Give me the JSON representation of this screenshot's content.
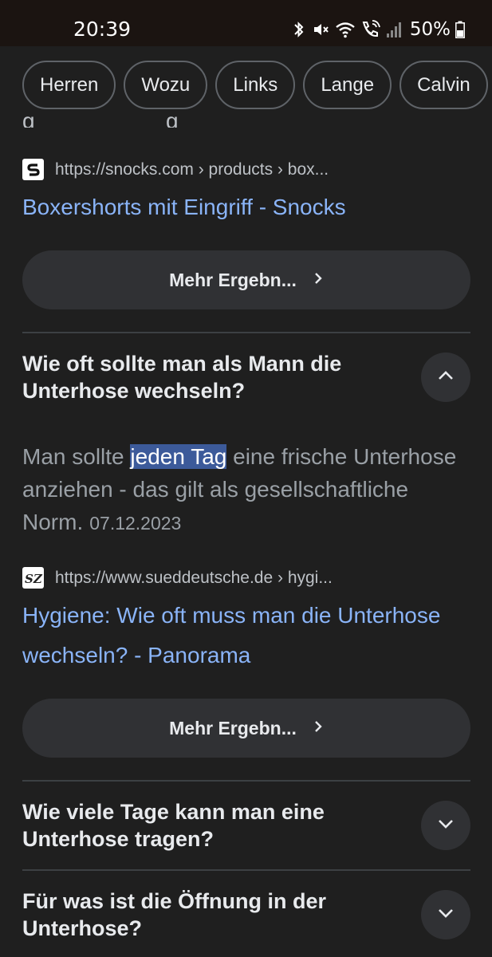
{
  "status_bar": {
    "time": "20:39",
    "battery": "50%",
    "icons": [
      "bluetooth-icon",
      "vibrate-mute-icon",
      "wifi-icon",
      "wifi-call-icon",
      "signal-icon",
      "battery-icon"
    ]
  },
  "chips": [
    "Herren",
    "Wozu",
    "Links",
    "Lange",
    "Calvin"
  ],
  "colors": {
    "background": "#1f1f1f",
    "link": "#8ab4f8",
    "highlight": "#3c5a9a",
    "button_bg": "#303134"
  },
  "results": [
    {
      "source_url": "https://snocks.com › products › box...",
      "title": "Boxershorts mit Eingriff - Snocks",
      "favicon": "snocks-logo",
      "more_label": "Mehr Ergebn..."
    }
  ],
  "questions": [
    {
      "title": "Wie oft sollte man als Mann die Unterhose wechseln?",
      "expanded": true,
      "answer_before": "Man sollte ",
      "answer_highlight": "jeden Tag",
      "answer_after": " eine frische Unterhose anziehen - das gilt als gesellschaftliche Norm.",
      "answer_date": "07.12.2023",
      "source_url": "https://www.sueddeutsche.de › hygi...",
      "favicon": "sz-logo",
      "link_title": "Hygiene: Wie oft muss man die Unterhose wechseln? - Panorama",
      "more_label": "Mehr Ergebn..."
    },
    {
      "title": "Wie viele Tage kann man eine Unterhose tragen?",
      "expanded": false
    },
    {
      "title": "Für was ist die Öffnung in der Unterhose?",
      "expanded": false
    }
  ]
}
